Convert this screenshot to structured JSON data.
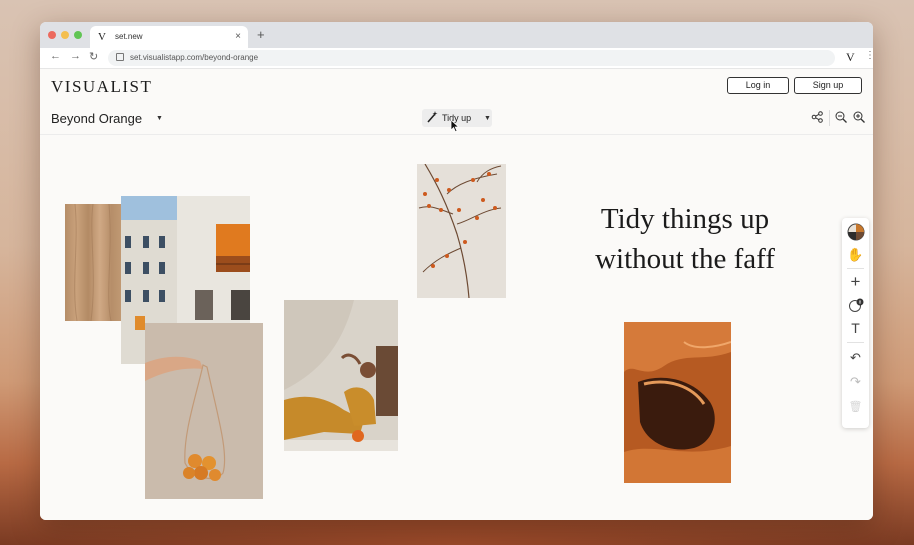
{
  "browser": {
    "tab_title": "set.new",
    "tab_favicon": "V",
    "url": "set.visualistapp.com/beyond-orange",
    "extension_glyph": "V",
    "close_tab_glyph": "×",
    "new_tab_glyph": "+",
    "back_glyph": "←",
    "forward_glyph": "→",
    "reload_glyph": "↻",
    "menu_glyph": "⋮",
    "traffic_colors": [
      "#ec6a5e",
      "#f4bf4f",
      "#61c554"
    ]
  },
  "app": {
    "logo": "VISUALIST",
    "login_label": "Log in",
    "signup_label": "Sign up",
    "board_name": "Beyond Orange",
    "board_caret": "▼",
    "tidy_label": "Tidy up",
    "tidy_icon": "wand-icon",
    "tidy_caret": "▼",
    "share_icon": "share-icon",
    "zoom_out_icon": "zoom-out-icon",
    "zoom_in_icon": "zoom-in-icon"
  },
  "canvas": {
    "headline_line1": "Tidy things up",
    "headline_line2": "without the faff",
    "images": [
      {
        "name": "wood-texture-image",
        "icon": "wood"
      },
      {
        "name": "building-facade-image",
        "icon": "building"
      },
      {
        "name": "net-bag-oranges-image",
        "icon": "bag"
      },
      {
        "name": "woman-reclining-image",
        "icon": "person"
      },
      {
        "name": "branch-berries-image",
        "icon": "branch"
      },
      {
        "name": "desert-rock-image",
        "icon": "rock"
      }
    ]
  },
  "tools": {
    "color_icon": "color-swatch-icon",
    "hand_glyph": "✋",
    "add_glyph": "+",
    "comment_badge": "8",
    "text_glyph": "T",
    "undo_glyph": "↶",
    "redo_glyph": "↷",
    "delete_glyph": "🗑"
  },
  "colors": {
    "accent_orange": "#d9772e",
    "ink": "#1b1b1b"
  }
}
